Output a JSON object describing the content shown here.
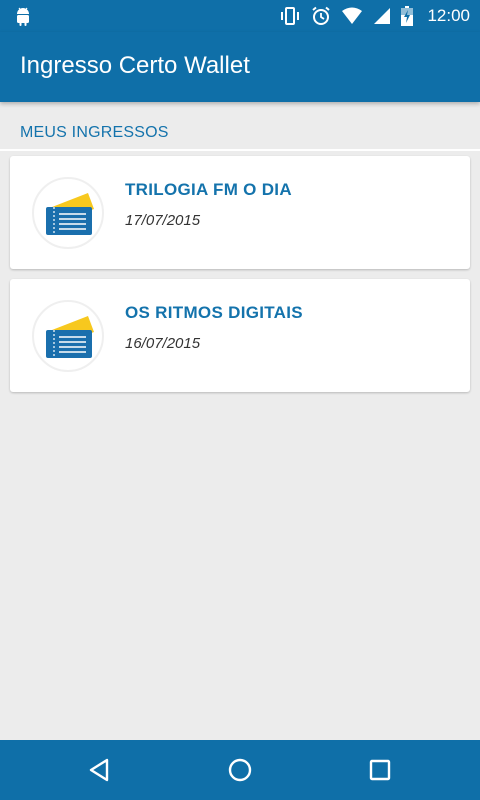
{
  "status_bar": {
    "time": "12:00",
    "icons": [
      "android-icon",
      "vibrate-icon",
      "alarm-icon",
      "wifi-icon",
      "signal-icon",
      "battery-charging-icon"
    ]
  },
  "app_bar": {
    "title": "Ingresso Certo Wallet"
  },
  "section": {
    "header": "MEUS INGRESSOS"
  },
  "tickets": [
    {
      "title": "TRILOGIA FM O DIA",
      "date": "17/07/2015",
      "icon": "ticket-icon"
    },
    {
      "title": "OS RITMOS DIGITAIS",
      "date": "16/07/2015",
      "icon": "ticket-icon"
    }
  ],
  "nav_bar": {
    "buttons": [
      "back-icon",
      "home-icon",
      "recents-icon"
    ]
  },
  "colors": {
    "primary": "#0f6fa8",
    "accent_text": "#1473ac",
    "background": "#ececec",
    "ticket_yellow": "#f7c81e",
    "ticket_blue": "#1a6fad"
  }
}
